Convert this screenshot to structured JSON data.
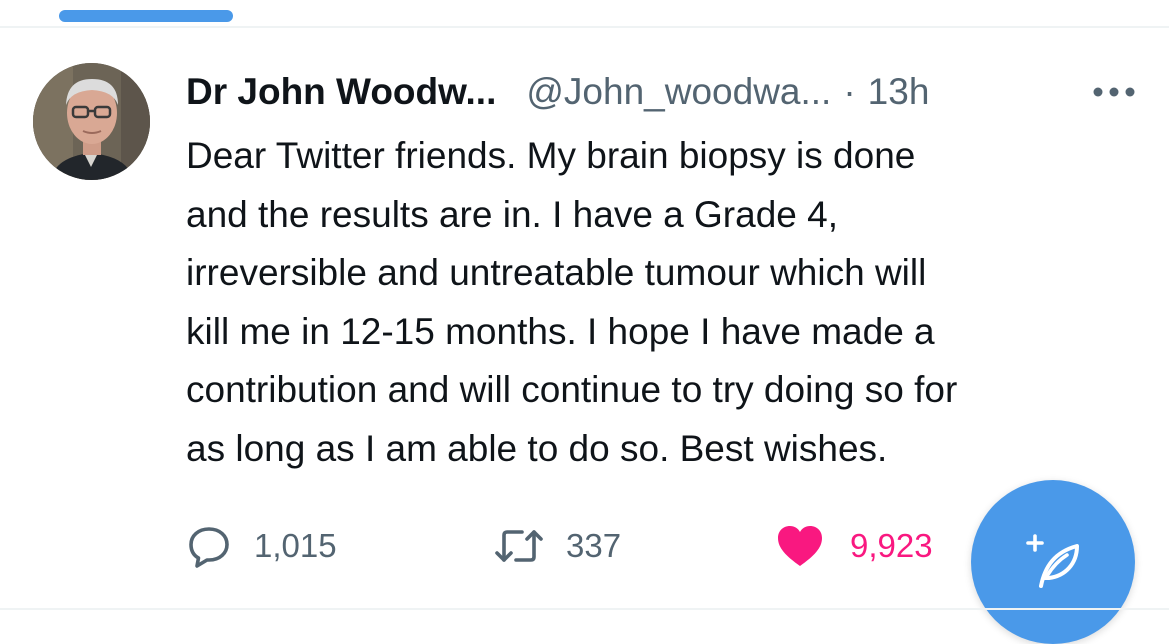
{
  "tweet": {
    "author_name": "Dr John Woodw...",
    "author_handle": "@John_woodwa...",
    "separator": "·",
    "timestamp": "13h",
    "text": "Dear Twitter friends. My brain biopsy is done\nand the results are in. I have a Grade 4,\nirreversible and untreatable tumour which will\nkill me in 12-15 months. I hope I have made a\ncontribution and will continue to try doing so for\nas long as I am able to do so. Best wishes."
  },
  "actions": {
    "replies": "1,015",
    "retweets": "337",
    "likes": "9,923"
  },
  "icons": {
    "more": "more-icon",
    "reply": "reply-icon",
    "retweet": "retweet-icon",
    "like": "heart-icon",
    "compose": "compose-feather-icon"
  },
  "colors": {
    "accent": "#4a99e9",
    "like": "#f91880",
    "secondary_text": "#536471",
    "primary_text": "#0f1419"
  }
}
